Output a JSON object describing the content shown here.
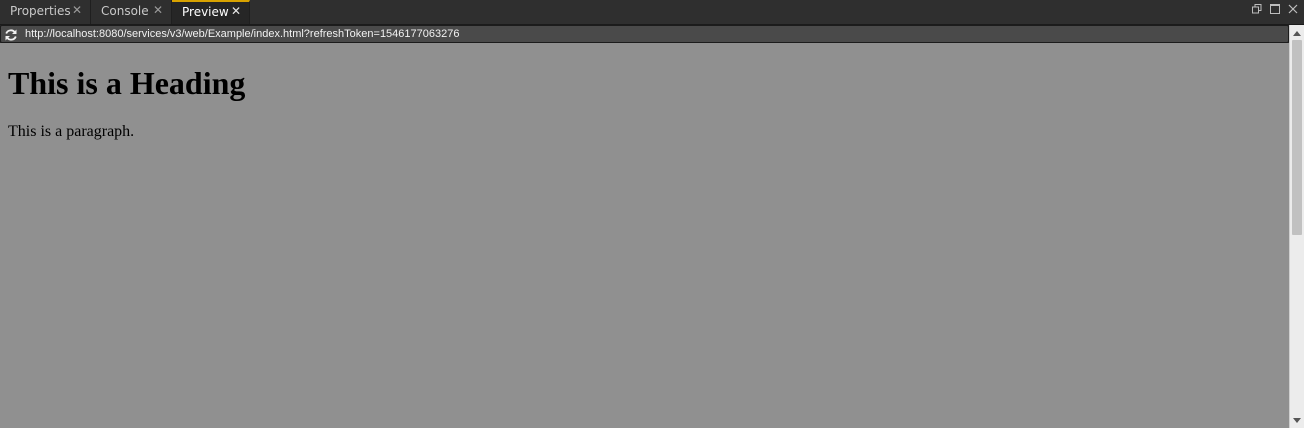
{
  "tabs": [
    {
      "label": "Properties",
      "close": "✕",
      "active": false
    },
    {
      "label": "Console",
      "close": "✕",
      "active": false
    },
    {
      "label": "Preview",
      "close": "✕",
      "active": true
    }
  ],
  "window_controls": [
    "restore-icon",
    "maximize-icon",
    "close-icon"
  ],
  "address_bar": {
    "refresh_icon": "refresh-icon",
    "url": "http://localhost:8080/services/v3/web/Example/index.html?refreshToken=1546177063276"
  },
  "preview": {
    "heading": "This is a Heading",
    "paragraph": "This is a paragraph."
  },
  "colors": {
    "accent": "#d8a200",
    "preview_background": "#909090",
    "tabbar_background": "#2f2f2f"
  }
}
